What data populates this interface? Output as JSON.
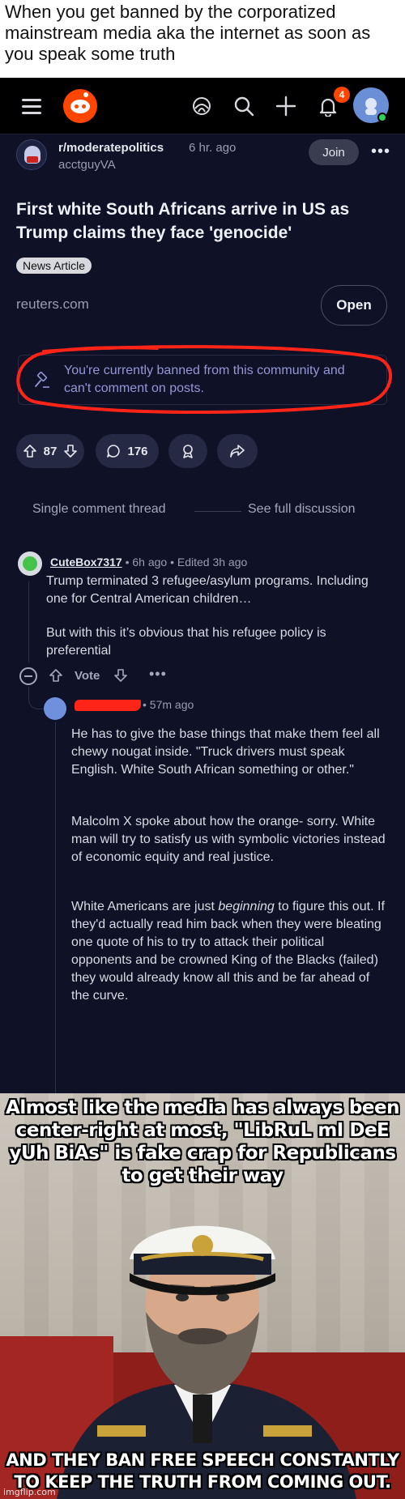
{
  "caption": {
    "text": "When you get banned by the corporatized mainstream media aka the internet as soon as you speak some truth"
  },
  "reddit": {
    "header": {
      "menu_icon": "hamburger-icon",
      "logo_icon": "reddit-logo",
      "icons": [
        "communities-icon",
        "search-icon",
        "plus-icon",
        "bell-icon"
      ],
      "notification_count": "4"
    },
    "post": {
      "subreddit": "r/moderatepolitics",
      "time": "6 hr. ago",
      "author": "acctguyVA",
      "join_label": "Join",
      "more_label": "•••",
      "title": "First white South Africans arrive in US as Trump claims they face 'genocide'",
      "flair": "News Article",
      "link_domain": "reuters.com",
      "open_label": "Open",
      "ban_message": "You're currently banned from this community and can't comment on posts.",
      "upvotes": "87",
      "comments": "176"
    },
    "thread_nav": {
      "single_label": "Single comment thread",
      "full_label": "See full discussion"
    },
    "comments": [
      {
        "username": "CuteBox7317",
        "meta": "• 6h ago • Edited 3h ago",
        "paragraphs": [
          "Trump terminated 3 refugee/asylum programs. Including one for Central American children…",
          "But with this it’s obvious that his refugee policy is preferential"
        ],
        "vote_label": "Vote",
        "more_label": "•••"
      },
      {
        "meta": "• 57m ago",
        "paragraphs": [
          "He has to give the base things that make them feel all chewy nougat inside. \"Truck drivers must speak English. White South African something or other.\"",
          "Malcolm X spoke about how the orange- sorry. White man will try to satisfy us with symbolic victories instead of economic equity and real justice.",
          "White Americans are just beginning to figure this out. If they'd actually read him back when they were bleating one quote of his to try to attack their political opponents and be crowned King of the Blacks (failed) they would already know all this and be far ahead of the curve."
        ]
      }
    ],
    "colors": {
      "background": "#0f1126",
      "accent": "#ff4500",
      "ban_text": "#9497d6",
      "annotation_red": "#ff2418"
    }
  },
  "meme": {
    "top_text": "Almost like the media has always been center-right at most, \"LibRuL mI DeE yUh BiAs\" is fake crap for Republicans to get their way",
    "bottom_text": "AND THEY BAN FREE SPEECH CONSTANTLY TO KEEP THE TRUTH FROM COMING OUT.",
    "watermark": "imgflip.com"
  }
}
